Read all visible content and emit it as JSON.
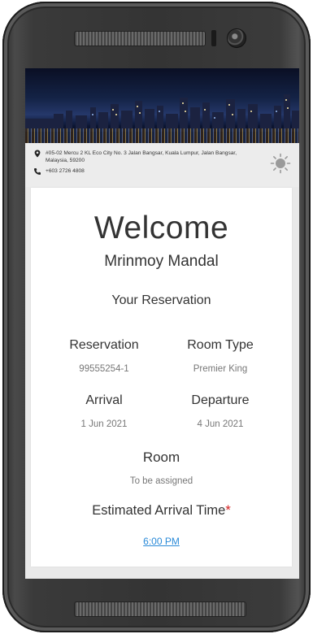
{
  "header": {
    "address": "#05-02 Mercu 2 KL Eco City No. 3 Jalan Bangsar, Kuala Lumpur, Jalan Bangsar, Malaysia, 59200",
    "phone": "+603 2726 4808"
  },
  "welcome": {
    "title": "Welcome",
    "guest_name": "Mrinmoy Mandal",
    "section_title": "Your Reservation"
  },
  "reservation": {
    "reservation_label": "Reservation",
    "reservation_value": "99555254-1",
    "room_type_label": "Room Type",
    "room_type_value": "Premier King",
    "arrival_label": "Arrival",
    "arrival_value": "1 Jun 2021",
    "departure_label": "Departure",
    "departure_value": "4 Jun 2021",
    "room_label": "Room",
    "room_value": "To be assigned",
    "eta_label": "Estimated Arrival Time",
    "eta_required_mark": "*",
    "eta_value": "6:00 PM"
  },
  "colors": {
    "link": "#2a8ad8",
    "required": "#d32020",
    "text": "#333333",
    "muted": "#777777"
  },
  "icons": [
    "location-pin-icon",
    "phone-icon",
    "sun-icon",
    "front-camera-icon"
  ]
}
